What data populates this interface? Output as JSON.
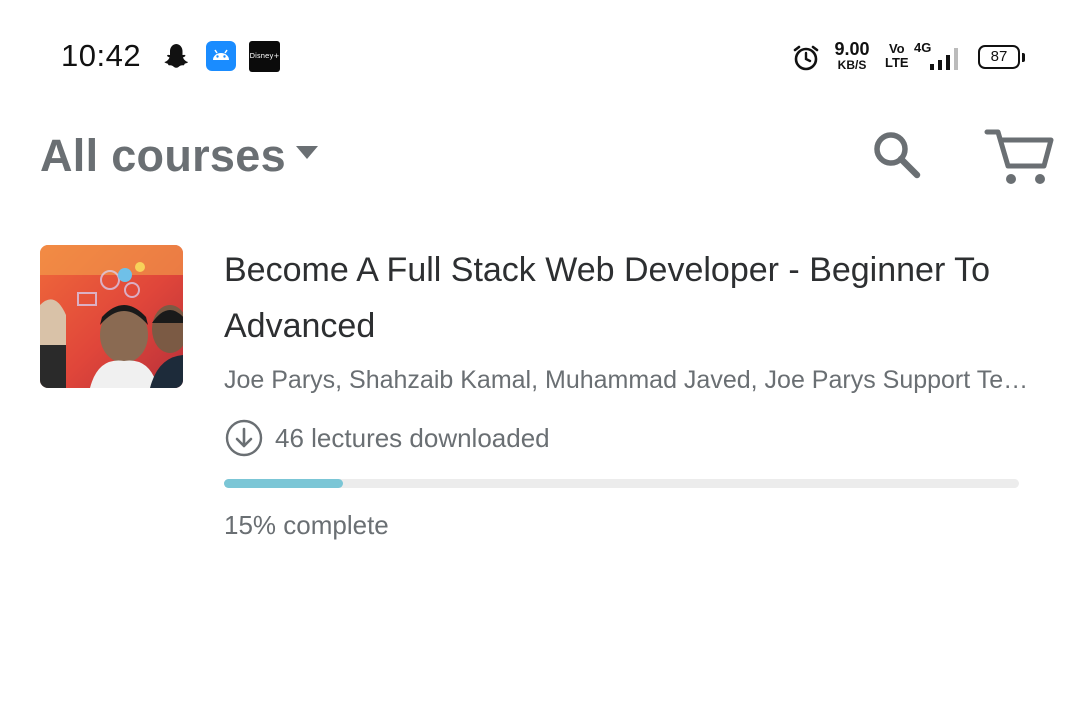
{
  "status_bar": {
    "time": "10:42",
    "icons": [
      "snapchat-icon",
      "android-app-icon",
      "hotstar-icon",
      "alarm-icon",
      "signal-icon",
      "battery-icon"
    ],
    "hotstar_label": "Disney+ hotstar",
    "speed_value": "9.00",
    "speed_unit": "KB/S",
    "volte_top": "Vo",
    "volte_bottom": "LTE",
    "network": "4G",
    "battery": "87"
  },
  "header": {
    "title": "All courses",
    "icons": [
      "chevron-down-icon",
      "search-icon",
      "cart-icon"
    ]
  },
  "course": {
    "title": "Become A Full Stack Web Developer - Beginner To Advanced",
    "instructors": "Joe Parys, Shahzaib Kamal, Muhammad Javed, Joe Parys Support Team",
    "downloads_text": "46 lectures downloaded",
    "progress_percent": 15,
    "progress_text": "15% complete"
  },
  "colors": {
    "accent": "#7bc6d6",
    "header_text": "#6a6f73",
    "title_text": "#2d2f31",
    "track": "#ececec"
  }
}
